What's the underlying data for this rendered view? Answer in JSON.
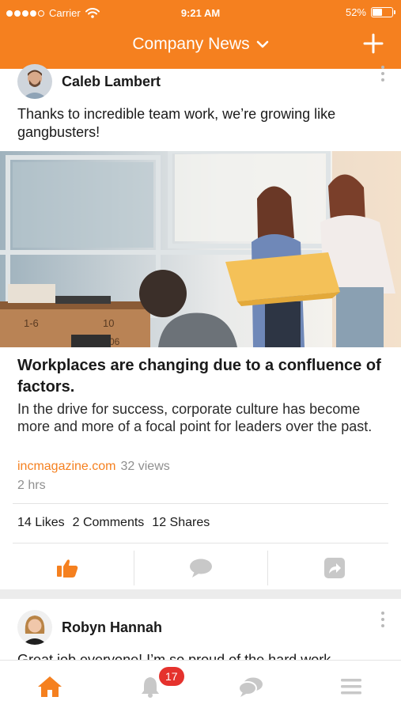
{
  "status_bar": {
    "carrier": "Carrier",
    "time": "9:21 AM",
    "battery": "52%"
  },
  "header": {
    "title": "Company News"
  },
  "posts": [
    {
      "author": "Caleb Lambert",
      "text": "Thanks to incredible team work, we’re growing like gangbusters!",
      "article": {
        "headline": "Workplaces are changing due to a confluence of factors.",
        "summary": "In the drive for success, corporate culture has become more and more of a focal point for leaders over the past.",
        "source": "incmagazine.com",
        "views": "32 views",
        "age": "2 hrs"
      },
      "stats": {
        "likes": "14 Likes",
        "comments": "2 Comments",
        "shares": "12 Shares"
      }
    },
    {
      "author": "Robyn Hannah",
      "text": "Great job everyone! I’m so proud of the hard work"
    }
  ],
  "tabbar": {
    "notification_count": "17"
  },
  "colors": {
    "accent": "#f5801f",
    "badge": "#e5322d",
    "inactive_icon": "#c8c8c8"
  },
  "icons": [
    "wifi-icon",
    "chevron-down-icon",
    "plus-icon",
    "like-icon",
    "comment-icon",
    "share-icon",
    "home-icon",
    "bell-icon",
    "chat-icon",
    "menu-icon"
  ]
}
